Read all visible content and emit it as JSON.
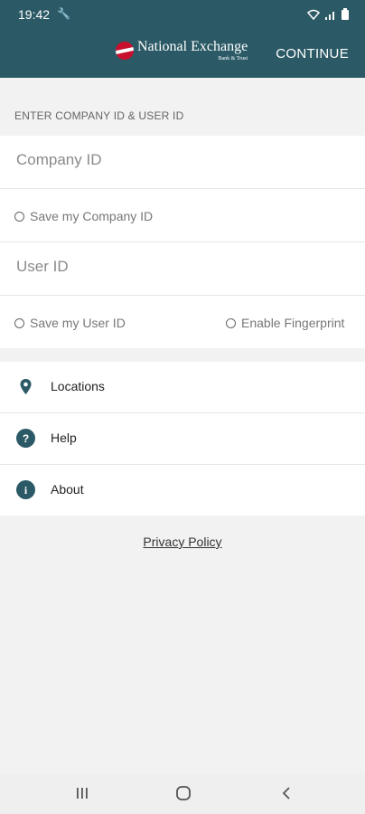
{
  "status_bar": {
    "time": "19:42"
  },
  "app_bar": {
    "logo_name": "National Exchange",
    "logo_sub": "Bank & Trust",
    "continue_label": "CONTINUE"
  },
  "login": {
    "section_header": "ENTER COMPANY ID & USER ID",
    "company_id_placeholder": "Company ID",
    "save_company_label": "Save my Company ID",
    "user_id_placeholder": "User ID",
    "save_user_label": "Save my User ID",
    "fingerprint_label": "Enable Fingerprint"
  },
  "menu": {
    "items": [
      {
        "label": "Locations",
        "icon": "location-pin-icon"
      },
      {
        "label": "Help",
        "icon": "help-icon"
      },
      {
        "label": "About",
        "icon": "info-icon"
      }
    ]
  },
  "footer": {
    "privacy_label": "Privacy Policy"
  },
  "colors": {
    "brand_teal": "#2b5a66",
    "logo_red": "#c8102e"
  }
}
